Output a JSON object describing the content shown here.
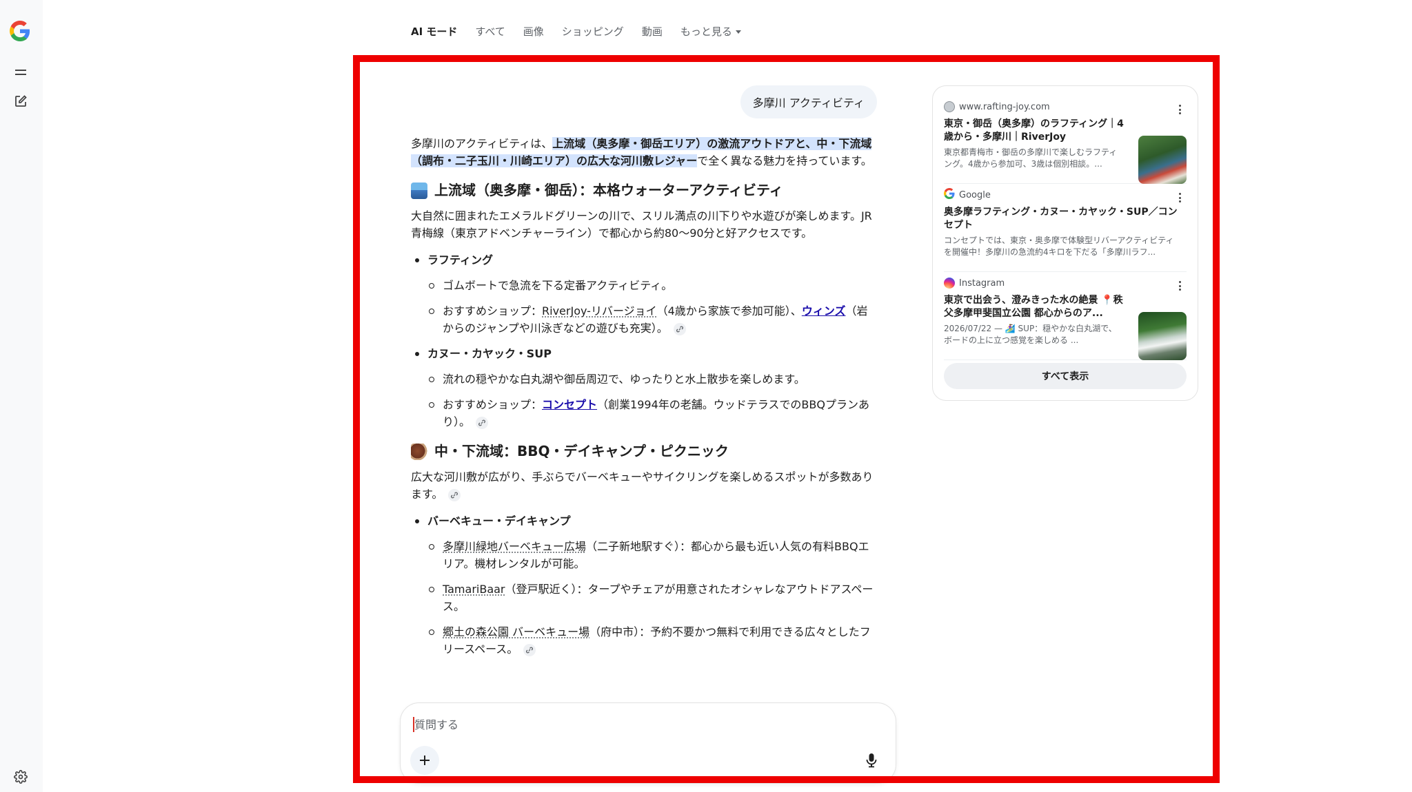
{
  "tabs": [
    {
      "label": "AI モード"
    },
    {
      "label": "すべて"
    },
    {
      "label": "画像"
    },
    {
      "label": "ショッピング"
    },
    {
      "label": "動画"
    },
    {
      "label": "もっと見る"
    }
  ],
  "query": "多摩川 アクティビティ",
  "intro": {
    "pre": "多摩川のアクティビティは、",
    "highlight": "上流域（奥多摩・御岳エリア）の激流アウトドアと、中・下流域（調布・二子玉川・川崎エリア）の広大な河川敷レジャー",
    "post": "で全く異なる魅力を持っています。"
  },
  "section1": {
    "heading": "上流域（奥多摩・御岳）：本格ウォーターアクティビティ",
    "desc": "大自然に囲まれたエメラルドグリーンの川で、スリル満点の川下りや水遊びが楽しめます。JR青梅線（東京アドベンチャーライン）で都心から約80〜90分と好アクセスです。",
    "items": [
      {
        "title": "ラフティング",
        "sub1": "ゴムボートで急流を下る定番アクティビティ。",
        "sub2_pre": "おすすめショップ：",
        "sub2_link1": "RiverJoy-リバージョイ",
        "sub2_mid": "（4歳から家族で参加可能）、",
        "sub2_link2": "ウィンズ",
        "sub2_post": "（岩からのジャンプや川泳ぎなどの遊びも充実）。"
      },
      {
        "title": "カヌー・カヤック・SUP",
        "sub1": "流れの穏やかな白丸湖や御岳周辺で、ゆったりと水上散歩を楽しめます。",
        "sub2_pre": "おすすめショップ：",
        "sub2_link1": "コンセプト",
        "sub2_post": "（創業1994年の老舗。ウッドテラスでのBBQプランあり）。"
      }
    ]
  },
  "section2": {
    "heading": "中・下流域：BBQ・デイキャンプ・ピクニック",
    "desc": "広大な河川敷が広がり、手ぶらでバーベキューやサイクリングを楽しめるスポットが多数あります。",
    "item_title": "バーベキュー・デイキャンプ",
    "spots": [
      {
        "name": "多摩川緑地バーベキュー広場",
        "text": "（二子新地駅すぐ）：都心から最も近い人気の有料BBQエリア。機材レンタルが可能。"
      },
      {
        "name": "TamariBaar",
        "text": "（登戸駅近く）：タープやチェアが用意されたオシャレなアウトドアスペース。"
      },
      {
        "name": "郷土の森公園 バーベキュー場",
        "text": "（府中市）：予約不要かつ無料で利用できる広々としたフリースペース。"
      }
    ]
  },
  "input": {
    "placeholder": "質問する"
  },
  "sources": [
    {
      "site": "www.rafting-joy.com",
      "title": "東京・御岳（奥多摩）のラフティング｜4歳から・多摩川｜RiverJoy",
      "snippet": "東京都青梅市・御岳の多摩川で楽しむラフティング。4歳から参加可、3歳は個別相談。..."
    },
    {
      "site": "Google",
      "title": "奥多摩ラフティング・カヌー・カヤック・SUP／コンセプト",
      "snippet": "コンセプトでは、東京・奥多摩で体験型リバーアクティビティを開催中！多摩川の急流約4キロを下だる「多摩川ラフ..."
    },
    {
      "site": "Instagram",
      "title": "東京で出会う、澄みきった水の絶景 📍秩父多摩甲斐国立公園 都心からのア...",
      "snippet": "2026/07/22 — 🏄‍♀️ SUP：穏やかな白丸湖で、ボードの上に立つ感覚を楽しめる ..."
    }
  ],
  "show_all": "すべて表示",
  "colors": {
    "highlight_frame": "#ee0000",
    "link": "#1a0dab",
    "highlight_bg": "#d3e3fd"
  }
}
